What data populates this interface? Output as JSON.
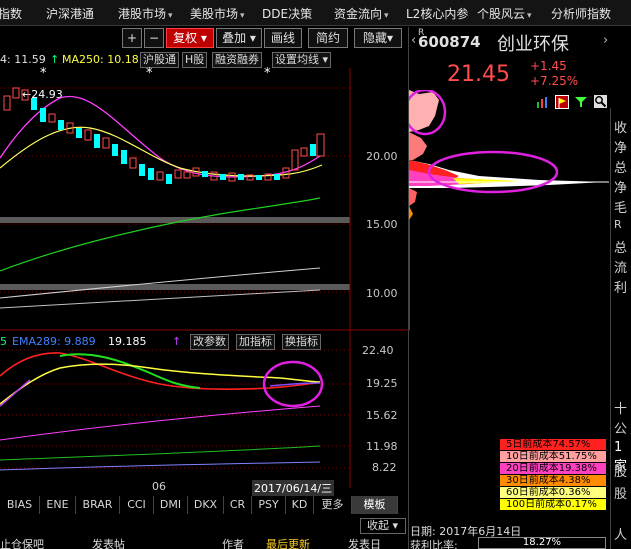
{
  "menu": [
    {
      "label": "指数",
      "arrow": false
    },
    {
      "label": "沪深港通",
      "arrow": false
    },
    {
      "label": "港股市场",
      "arrow": true
    },
    {
      "label": "美股市场",
      "arrow": true
    },
    {
      "label": "DDE决策",
      "arrow": false
    },
    {
      "label": "资金流向",
      "arrow": true
    },
    {
      "label": "L2核心内参",
      "arrow": false
    },
    {
      "label": "个股风云",
      "arrow": true
    },
    {
      "label": "分析师指数",
      "arrow": false
    }
  ],
  "toolbar": {
    "plus": "+",
    "minus": "−",
    "restore_rights": "复权",
    "overlay": "叠加",
    "draw_line": "画线",
    "brief": "简约",
    "hide": "隐藏"
  },
  "ma_row": {
    "ma_fragment": "4: 11.59",
    "up_arrow": "↑",
    "ma250": "MA250: 10.18",
    "tags": [
      "沪股通",
      "H股",
      "融资融券",
      "设置均线"
    ],
    "star": "*",
    "peak_label": "24.93"
  },
  "price_axis": [
    "20.00",
    "15.00",
    "10.00"
  ],
  "indicator_row": {
    "prefix": "5",
    "ema": "EMA289: 9.889",
    "value": "19.185",
    "up_arrow": "↑",
    "buttons": [
      "改参数",
      "加指标",
      "换指标"
    ]
  },
  "indicator_axis": [
    "22.40",
    "19.25",
    "15.62",
    "11.98",
    "8.22"
  ],
  "date_row": {
    "month": "06",
    "date": "2017/06/14/三"
  },
  "tabs": [
    "BIAS",
    "ENE",
    "BRAR",
    "CCI",
    "DMI",
    "DKX",
    "CR",
    "PSY",
    "KD",
    "更多",
    "模板"
  ],
  "collapse": "收起",
  "stock": {
    "code_prefix": "R",
    "code": "600874",
    "name": "创业环保",
    "price": "21.45",
    "change": "+1.45",
    "change_pct": "+7.25%"
  },
  "side_chars": [
    "收",
    "净",
    "总",
    "净",
    "毛",
    "R",
    "总",
    "流",
    "利",
    "十",
    "公",
    "1家",
    "股",
    "股",
    "人"
  ],
  "cost_legend": [
    {
      "label": "5日前成本74.57%",
      "color": "#ff2020"
    },
    {
      "label": "10日前成本51.75%",
      "color": "#ff9f9f"
    },
    {
      "label": "20日前成本19.38%",
      "color": "#ff40c0"
    },
    {
      "label": "30日前成本4.38%",
      "color": "#ff8c00"
    },
    {
      "label": "60日前成本0.36%",
      "color": "#ffff80"
    },
    {
      "label": "100日前成本0.17%",
      "color": "#ffff00"
    }
  ],
  "date_label": "日期: 2017年6月14日",
  "profit_label": "获利比率:",
  "profit_value": "18.27%",
  "status": {
    "left": "止仓保吧",
    "mid": "发表帖",
    "author": "作者",
    "latest": "最后更新",
    "publish": "发表日"
  },
  "colors": {
    "up": "#ff4d4d",
    "down": "#00ffff",
    "highlight_circle": "#e020e0"
  }
}
